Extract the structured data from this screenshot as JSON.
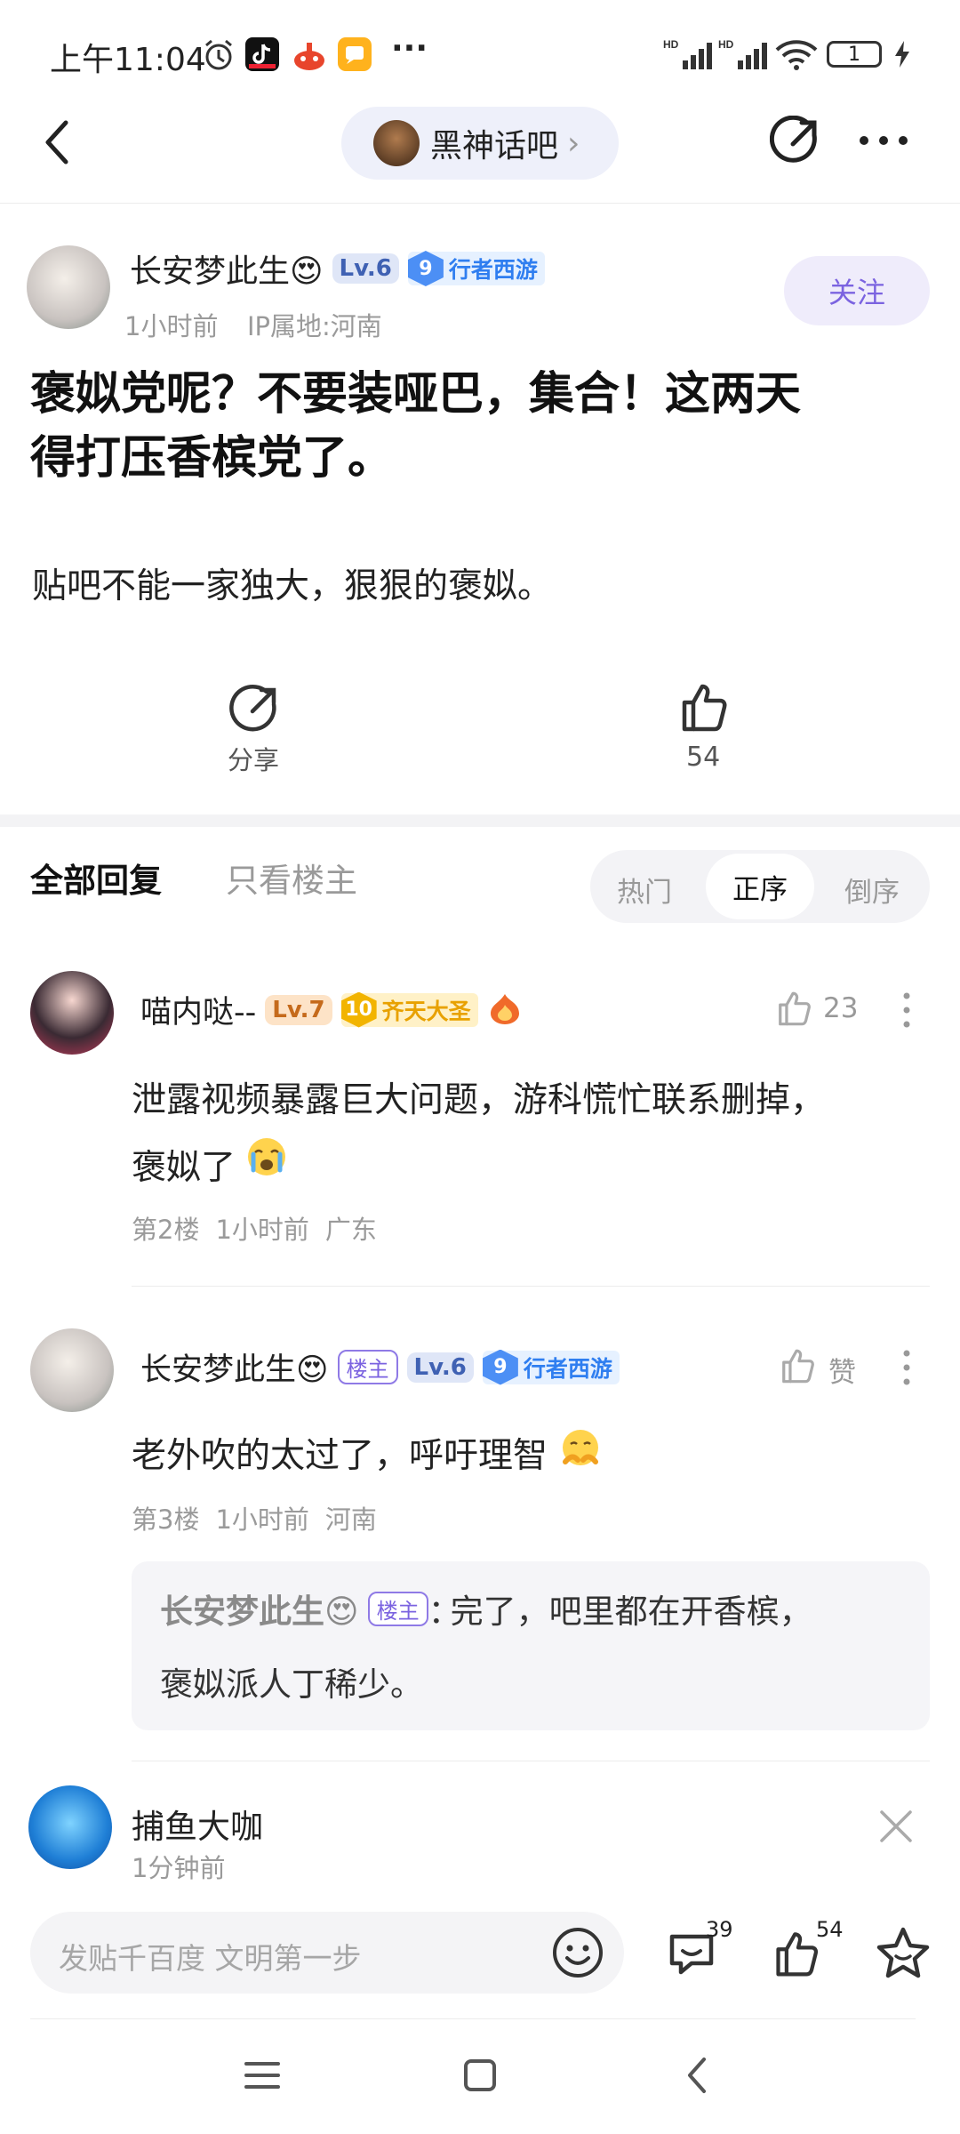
{
  "status_bar": {
    "time": "上午11:04",
    "dots": "···",
    "battery": "1"
  },
  "nav": {
    "forum_title": "黑神话吧",
    "chevron": "›"
  },
  "post": {
    "author": "长安梦此生😍",
    "level": "Lv.6",
    "honor_level": "9",
    "honor_title": "行者西游",
    "meta_time": "1小时前",
    "meta_ip": "IP属地:河南",
    "follow_label": "关注",
    "title_line1": "褒姒党呢？不要装哑巴，集合！这两天",
    "title_line2": "得打压香槟党了。",
    "body": "贴吧不能一家独大，狠狠的褒姒。",
    "share_label": "分享",
    "like_count": "54"
  },
  "reply_header": {
    "tab_all": "全部回复",
    "tab_op_only": "只看楼主",
    "sort_hot": "热门",
    "sort_asc": "正序",
    "sort_desc": "倒序"
  },
  "replies": [
    {
      "author": "喵内哒--",
      "level": "Lv.7",
      "honor_level": "10",
      "honor_title": "齐天大圣",
      "likes": "23",
      "text_line1": "泄露视频暴露巨大问题，游科慌忙联系删掉，",
      "text_line2": "褒姒了",
      "floor": "第2楼",
      "time": "1小时前",
      "location": "广东"
    },
    {
      "author": "长安梦此生😍",
      "host_label": "楼主",
      "level": "Lv.6",
      "honor_level": "9",
      "honor_title": "行者西游",
      "likes": "赞",
      "text": "老外吹的太过了，呼吁理智",
      "floor": "第3楼",
      "time": "1小时前",
      "location": "河南",
      "sub_reply": {
        "author": "长安梦此生😍",
        "host_label": "楼主",
        "colon": "：",
        "text_line1": "完了，吧里都在开香槟，",
        "text_line2": "褒姒派人丁稀少。"
      }
    }
  ],
  "notification": {
    "name": "捕鱼大咖",
    "time": "1分钟前"
  },
  "bottom_bar": {
    "input_placeholder": "发贴千百度 文明第一步",
    "comment_count": "39",
    "like_count": "54"
  },
  "colors": {
    "accent": "#7b63e0",
    "follow_bg": "#efecfb",
    "link_blue": "#2f7ef0"
  }
}
